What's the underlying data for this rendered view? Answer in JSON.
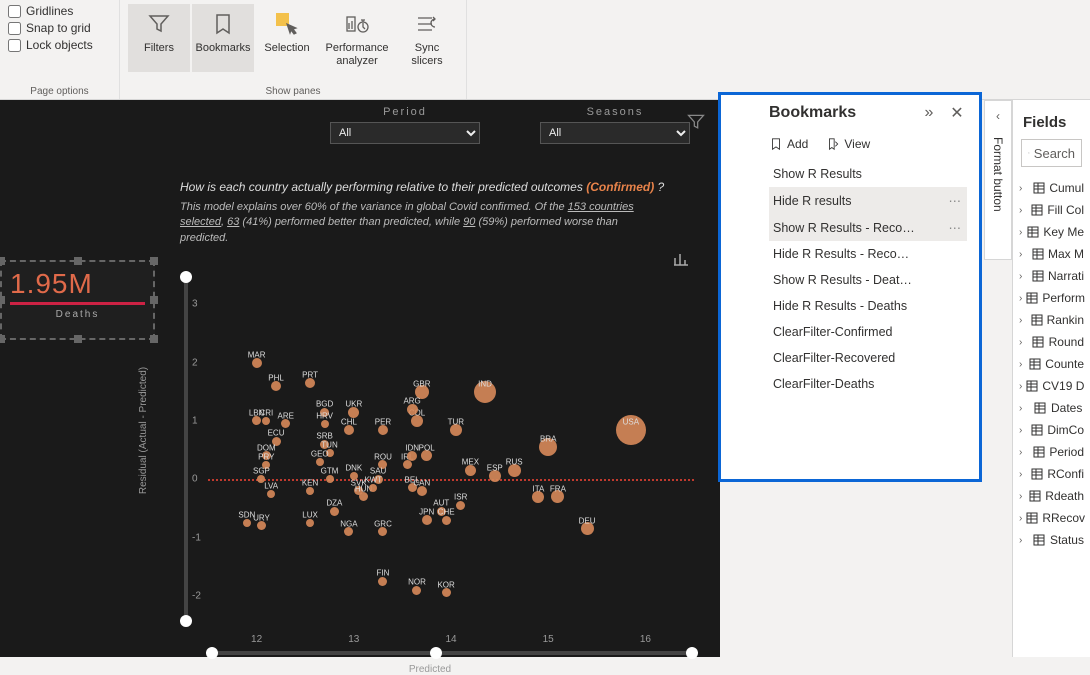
{
  "ribbon": {
    "page_options": {
      "items": [
        "Gridlines",
        "Snap to grid",
        "Lock objects"
      ],
      "group_label": "Page options"
    },
    "show_panes": {
      "filters": "Filters",
      "bookmarks": "Bookmarks",
      "selection": "Selection",
      "performance": "Performance analyzer",
      "sync": "Sync slicers",
      "group_label": "Show panes"
    }
  },
  "canvas": {
    "period_label": "Period",
    "seasons_label": "Seasons",
    "period_value": "All",
    "seasons_value": "All",
    "kpi": {
      "title": "",
      "value": "1.95M",
      "sub": "Deaths"
    },
    "title_pre": "How is each country actually performing relative to their predicted outcomes ",
    "title_accent": "(Confirmed)",
    "title_post": " ?",
    "desc_a": "This model explains over 60% of the variance in global Covid confirmed. Of the ",
    "desc_b": "153 countries selected",
    "desc_c": ", ",
    "desc_d": "63",
    "desc_e": " (41%) performed better than predicted, while ",
    "desc_f": "90",
    "desc_g": " (59%) performed worse than predicted.",
    "y_axis": "Residual (Actual - Predicted)",
    "x_axis": "Predicted"
  },
  "chart_data": {
    "type": "scatter",
    "title": "How is each country actually performing relative to their predicted outcomes (Confirmed) ?",
    "xlabel": "Predicted",
    "ylabel": "Residual (Actual - Predicted)",
    "xlim": [
      11.5,
      16.5
    ],
    "ylim": [
      -2.5,
      3.5
    ],
    "x_ticks": [
      12,
      13,
      14,
      15,
      16
    ],
    "y_ticks": [
      -2,
      -1,
      0,
      1,
      2,
      3
    ],
    "zero_line_y": 0,
    "points": [
      {
        "label": "MAR",
        "x": 12.0,
        "y": 2.0,
        "size": 10
      },
      {
        "label": "PHL",
        "x": 12.2,
        "y": 1.6,
        "size": 10
      },
      {
        "label": "LBN",
        "x": 12.0,
        "y": 1.0,
        "size": 9
      },
      {
        "label": "CRI",
        "x": 12.1,
        "y": 1.0,
        "size": 8
      },
      {
        "label": "ARE",
        "x": 12.3,
        "y": 0.95,
        "size": 9
      },
      {
        "label": "ECU",
        "x": 12.2,
        "y": 0.65,
        "size": 9
      },
      {
        "label": "DOM",
        "x": 12.1,
        "y": 0.4,
        "size": 9
      },
      {
        "label": "PRY",
        "x": 12.1,
        "y": 0.25,
        "size": 8
      },
      {
        "label": "SGP",
        "x": 12.05,
        "y": 0.0,
        "size": 8
      },
      {
        "label": "LVA",
        "x": 12.15,
        "y": -0.25,
        "size": 8
      },
      {
        "label": "URY",
        "x": 12.05,
        "y": -0.8,
        "size": 9
      },
      {
        "label": "SDN",
        "x": 11.9,
        "y": -0.75,
        "size": 8
      },
      {
        "label": "PRT",
        "x": 12.55,
        "y": 1.65,
        "size": 10
      },
      {
        "label": "BGD",
        "x": 12.7,
        "y": 1.15,
        "size": 9
      },
      {
        "label": "HRV",
        "x": 12.7,
        "y": 0.95,
        "size": 8
      },
      {
        "label": "SRB",
        "x": 12.7,
        "y": 0.6,
        "size": 9
      },
      {
        "label": "TUN",
        "x": 12.75,
        "y": 0.45,
        "size": 8
      },
      {
        "label": "GEO",
        "x": 12.65,
        "y": 0.3,
        "size": 8
      },
      {
        "label": "GTM",
        "x": 12.75,
        "y": 0.0,
        "size": 8
      },
      {
        "label": "KEN",
        "x": 12.55,
        "y": -0.2,
        "size": 8
      },
      {
        "label": "LUX",
        "x": 12.55,
        "y": -0.75,
        "size": 8
      },
      {
        "label": "DZA",
        "x": 12.8,
        "y": -0.55,
        "size": 9
      },
      {
        "label": "NGA",
        "x": 12.95,
        "y": -0.9,
        "size": 9
      },
      {
        "label": "UKR",
        "x": 13.0,
        "y": 1.15,
        "size": 11
      },
      {
        "label": "CHL",
        "x": 12.95,
        "y": 0.85,
        "size": 10
      },
      {
        "label": "SVK",
        "x": 13.05,
        "y": -0.2,
        "size": 9
      },
      {
        "label": "DNK",
        "x": 13.0,
        "y": 0.05,
        "size": 8
      },
      {
        "label": "HUN",
        "x": 13.1,
        "y": -0.3,
        "size": 9
      },
      {
        "label": "PER",
        "x": 13.3,
        "y": 0.85,
        "size": 10
      },
      {
        "label": "ROU",
        "x": 13.3,
        "y": 0.25,
        "size": 9
      },
      {
        "label": "SAU",
        "x": 13.25,
        "y": 0.0,
        "size": 9
      },
      {
        "label": "KWT",
        "x": 13.2,
        "y": -0.15,
        "size": 8
      },
      {
        "label": "GRC",
        "x": 13.3,
        "y": -0.9,
        "size": 9
      },
      {
        "label": "FIN",
        "x": 13.3,
        "y": -1.75,
        "size": 9
      },
      {
        "label": "GBR",
        "x": 13.7,
        "y": 1.5,
        "size": 14
      },
      {
        "label": "COL",
        "x": 13.65,
        "y": 1.0,
        "size": 12
      },
      {
        "label": "ARG",
        "x": 13.6,
        "y": 1.2,
        "size": 11
      },
      {
        "label": "IRL",
        "x": 13.55,
        "y": 0.25,
        "size": 9
      },
      {
        "label": "IDN",
        "x": 13.6,
        "y": 0.4,
        "size": 10
      },
      {
        "label": "POL",
        "x": 13.75,
        "y": 0.4,
        "size": 11
      },
      {
        "label": "BEL",
        "x": 13.6,
        "y": -0.15,
        "size": 9
      },
      {
        "label": "CAN",
        "x": 13.7,
        "y": -0.2,
        "size": 10
      },
      {
        "label": "JPN",
        "x": 13.75,
        "y": -0.7,
        "size": 10
      },
      {
        "label": "AUT",
        "x": 13.9,
        "y": -0.55,
        "size": 9
      },
      {
        "label": "CHE",
        "x": 13.95,
        "y": -0.7,
        "size": 9
      },
      {
        "label": "NOR",
        "x": 13.65,
        "y": -1.9,
        "size": 9
      },
      {
        "label": "KOR",
        "x": 13.95,
        "y": -1.95,
        "size": 9
      },
      {
        "label": "IND",
        "x": 14.35,
        "y": 1.5,
        "size": 22
      },
      {
        "label": "TUR",
        "x": 14.05,
        "y": 0.85,
        "size": 12
      },
      {
        "label": "MEX",
        "x": 14.2,
        "y": 0.15,
        "size": 11
      },
      {
        "label": "ESP",
        "x": 14.45,
        "y": 0.05,
        "size": 12
      },
      {
        "label": "ISR",
        "x": 14.1,
        "y": -0.45,
        "size": 9
      },
      {
        "label": "RUS",
        "x": 14.65,
        "y": 0.15,
        "size": 13
      },
      {
        "label": "BRA",
        "x": 15.0,
        "y": 0.55,
        "size": 18
      },
      {
        "label": "ITA",
        "x": 14.9,
        "y": -0.3,
        "size": 12
      },
      {
        "label": "FRA",
        "x": 15.1,
        "y": -0.3,
        "size": 13
      },
      {
        "label": "DEU",
        "x": 15.4,
        "y": -0.85,
        "size": 13
      },
      {
        "label": "USA",
        "x": 15.85,
        "y": 0.85,
        "size": 30
      }
    ]
  },
  "filters_tab": "Filters",
  "format_tab": "Format button",
  "bookmarks": {
    "title": "Bookmarks",
    "add": "Add",
    "view": "View",
    "items": [
      {
        "label": "Show R Results",
        "highlight": false,
        "dots": false
      },
      {
        "label": "Hide R results",
        "highlight": true,
        "dots": true
      },
      {
        "label": "Show R Results - Reco…",
        "highlight": true,
        "dots": true
      },
      {
        "label": "Hide R Results - Reco…",
        "highlight": false,
        "dots": false
      },
      {
        "label": "Show R Results - Deat…",
        "highlight": false,
        "dots": false
      },
      {
        "label": "Hide R Results - Deaths",
        "highlight": false,
        "dots": false
      },
      {
        "label": "ClearFilter-Confirmed",
        "highlight": false,
        "dots": false
      },
      {
        "label": "ClearFilter-Recovered",
        "highlight": false,
        "dots": false
      },
      {
        "label": "ClearFilter-Deaths",
        "highlight": false,
        "dots": false
      }
    ]
  },
  "fields": {
    "title": "Fields",
    "search_placeholder": "Search",
    "items": [
      {
        "label": "Cumul",
        "icon": "table",
        "nested": true
      },
      {
        "label": "Fill Col",
        "icon": "table",
        "nested": true
      },
      {
        "label": "Key Me",
        "icon": "table",
        "nested": true
      },
      {
        "label": "Max M",
        "icon": "table",
        "nested": true
      },
      {
        "label": "Narrati",
        "icon": "table",
        "nested": true
      },
      {
        "label": "Perform",
        "icon": "table",
        "nested": true
      },
      {
        "label": "Rankin",
        "icon": "table",
        "nested": true
      },
      {
        "label": "Round",
        "icon": "table",
        "nested": true
      },
      {
        "label": "Counte",
        "icon": "table",
        "nested": false
      },
      {
        "label": "CV19 D",
        "icon": "table",
        "nested": false
      },
      {
        "label": "Dates",
        "icon": "table",
        "nested": false
      },
      {
        "label": "DimCo",
        "icon": "table",
        "nested": false
      },
      {
        "label": "Period",
        "icon": "table",
        "nested": false
      },
      {
        "label": "RConfi",
        "icon": "table",
        "nested": false
      },
      {
        "label": "Rdeath",
        "icon": "table",
        "nested": false
      },
      {
        "label": "RRecov",
        "icon": "table",
        "nested": false
      },
      {
        "label": "Status",
        "icon": "table",
        "nested": false
      }
    ]
  }
}
